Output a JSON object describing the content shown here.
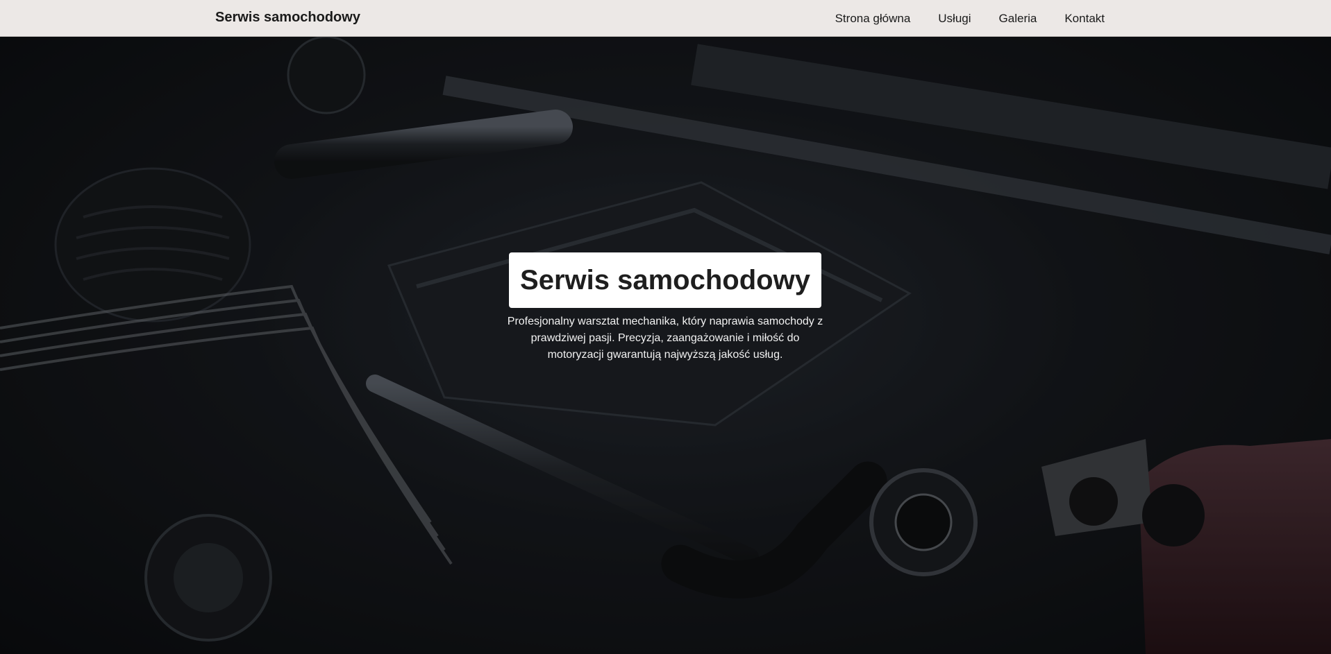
{
  "navbar": {
    "brand": "Serwis samochodowy",
    "links": [
      {
        "label": "Strona główna"
      },
      {
        "label": "Usługi"
      },
      {
        "label": "Galeria"
      },
      {
        "label": "Kontakt"
      }
    ]
  },
  "hero": {
    "title": "Serwis samochodowy",
    "description": "Profesjonalny warsztat mechanika, który naprawia samochody z prawdziwej pasji. Precyzja, zaangażowanie i miłość do motoryzacji gwarantują najwyższą jakość usług.",
    "background_image": "car-engine-bay-photo"
  },
  "colors": {
    "navbar_bg": "#ece8e6",
    "hero_title_bg": "#ffffff",
    "text_dark": "#1a1a1a",
    "text_light": "#f2f2f2"
  }
}
